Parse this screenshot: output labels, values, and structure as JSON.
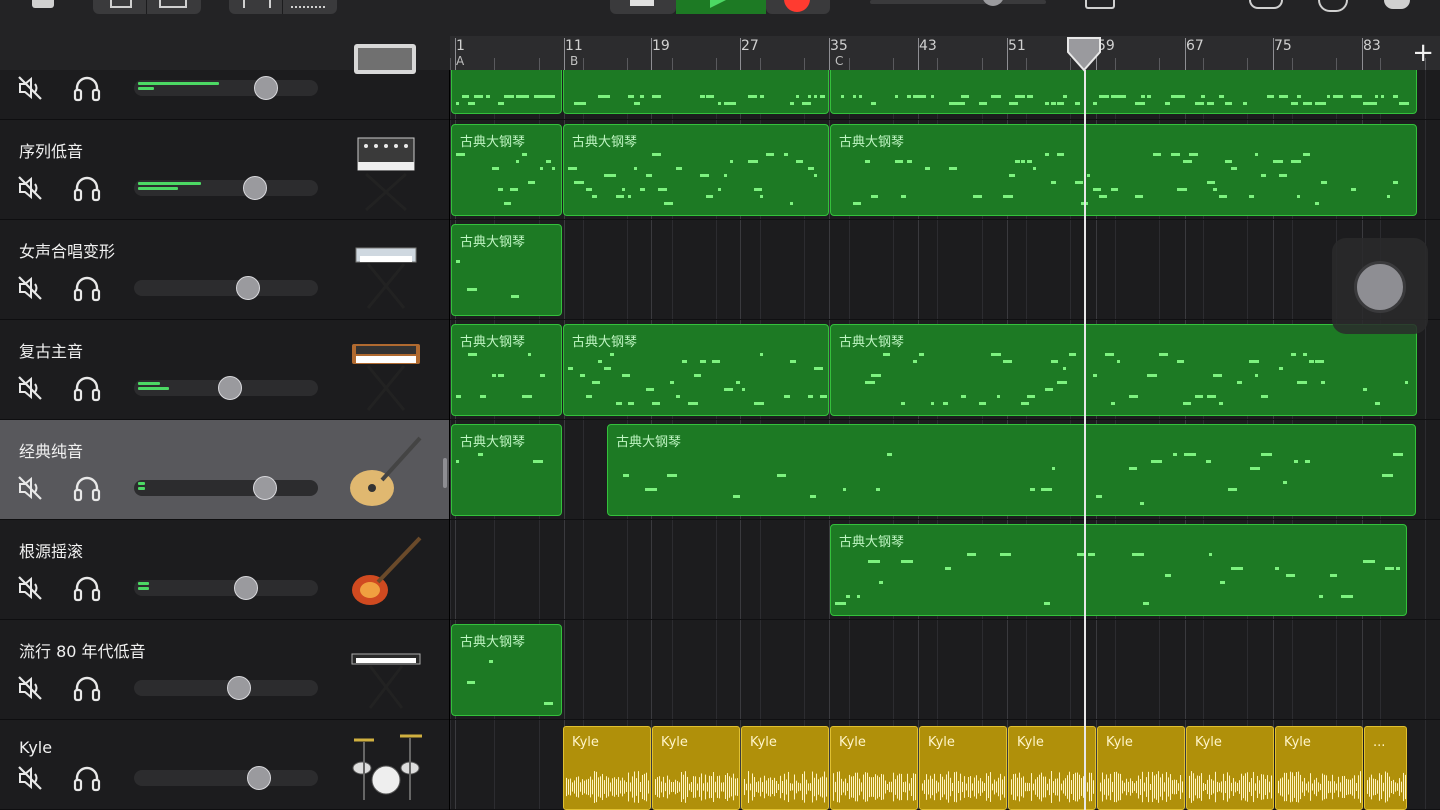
{
  "toolbar": {
    "buttons": [
      "browser-button",
      "track-view-button",
      "keyboard-button",
      "mixer-button",
      "loop-browser-button",
      "stop-button",
      "play-button",
      "record-button",
      "master-volume",
      "metronome-button",
      "tempo-button",
      "settings-button",
      "help-button"
    ]
  },
  "ruler": {
    "bars": [
      "1",
      "11",
      "19",
      "27",
      "35",
      "43",
      "51",
      "59",
      "67",
      "75",
      "83"
    ],
    "sections": [
      "A",
      "B",
      "C"
    ]
  },
  "colors": {
    "midi_region": "#1d7a24",
    "midi_border": "#34c03c",
    "audio_region": "#b0900a",
    "meter": "#4cd964",
    "selected_track": "#58585c"
  },
  "tracks": [
    {
      "name": "",
      "instrument_icon": "amp-icon",
      "volume": 0.72,
      "meter_level": [
        0.45,
        0.09
      ],
      "selected": false
    },
    {
      "name": "序列低音",
      "instrument_icon": "modular-synth-icon",
      "volume": 0.66,
      "meter_level": [
        0.35,
        0.22
      ],
      "selected": false
    },
    {
      "name": "女声合唱变形",
      "instrument_icon": "keyboard-stand-icon",
      "volume": 0.62,
      "meter_level": [
        0,
        0
      ],
      "selected": false
    },
    {
      "name": "复古主音",
      "instrument_icon": "analog-synth-icon",
      "volume": 0.52,
      "meter_level": [
        0.12,
        0.17
      ],
      "selected": false
    },
    {
      "name": "经典纯音",
      "instrument_icon": "hollow-body-guitar-icon",
      "volume": 0.71,
      "meter_level": [
        0.04,
        0.04
      ],
      "selected": true
    },
    {
      "name": "根源摇滚",
      "instrument_icon": "electric-guitar-icon",
      "volume": 0.61,
      "meter_level": [
        0.06,
        0.06
      ],
      "selected": false
    },
    {
      "name": "流行 80 年代低音",
      "instrument_icon": "keytar-stand-icon",
      "volume": 0.57,
      "meter_level": [
        0,
        0
      ],
      "selected": false
    },
    {
      "name": "Kyle",
      "instrument_icon": "drum-kit-icon",
      "volume": 0.68,
      "meter_level": [
        0,
        0
      ],
      "selected": false
    }
  ],
  "midi_region_label": "古典大钢琴",
  "audio_region_label": "Kyle",
  "audio_region_labels": [
    "Kyle",
    "Kyle",
    "Kyle",
    "Kyle",
    "Kyle",
    "Kyle",
    "Kyle",
    "Kyle",
    "Kyle",
    "..."
  ],
  "add_section_label": "+"
}
